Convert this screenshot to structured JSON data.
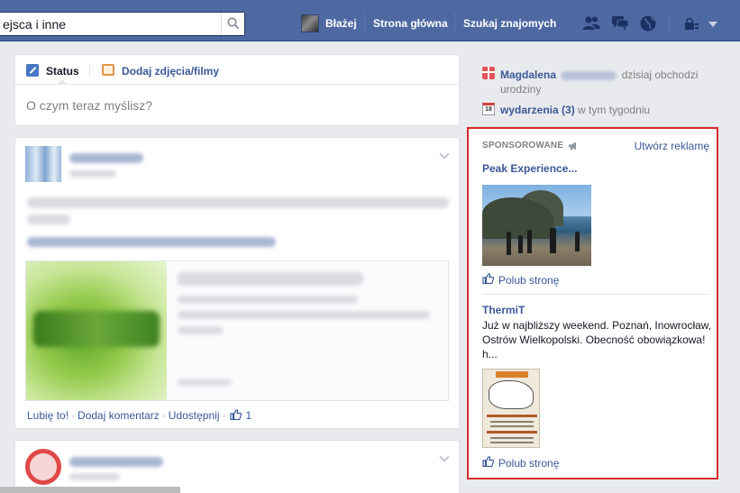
{
  "topbar": {
    "search_value": "ejsca i inne",
    "user_name": "Błażej",
    "home_label": "Strona główna",
    "find_friends_label": "Szukaj znajomych"
  },
  "composer": {
    "status_label": "Status",
    "photo_label": "Dodaj zdjęcia/filmy",
    "placeholder": "O czym teraz myślisz?"
  },
  "story": {
    "like_label": "Lubię to!",
    "comment_label": "Dodaj komentarz",
    "share_label": "Udostępnij",
    "like_count": "1"
  },
  "reminders": {
    "birthday_name": "Magdalena",
    "birthday_text": "dzisiaj obchodzi urodziny",
    "calendar_day": "18",
    "events_label": "wydarzenia (3)",
    "events_suffix": "w tym tygodniu"
  },
  "sponsored": {
    "header": "SPONSOROWANE",
    "create_ad": "Utwórz reklamę",
    "ads": [
      {
        "title": "Peak Experience...",
        "like_label": "Polub stronę"
      },
      {
        "title": "ThermiT",
        "description": "Już w najbliższy weekend. Poznań, Inowrocław, Ostrów Wielkopolski. Obecność obowiązkowa! h...",
        "like_label": "Polub stronę"
      }
    ]
  },
  "colors": {
    "topbar": "#4e69a2",
    "link": "#3b5998",
    "highlight_border": "#d62a2a",
    "background": "#e9eaed"
  }
}
